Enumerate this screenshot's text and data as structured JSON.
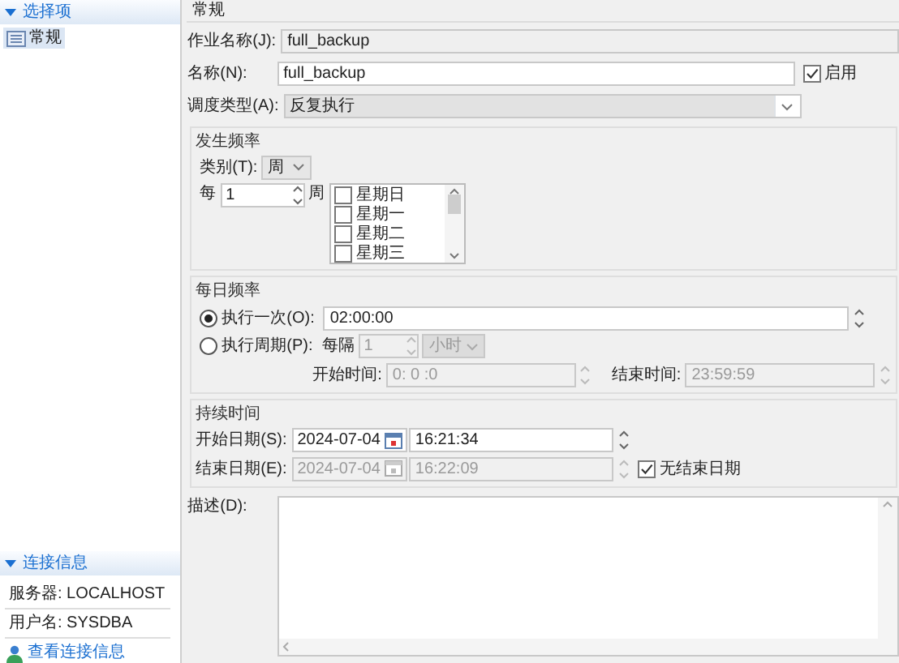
{
  "options_panel": {
    "title": "选择项",
    "expanded": true,
    "items": [
      {
        "label": "常规",
        "selected": true
      }
    ]
  },
  "connection_panel": {
    "title": "连接信息",
    "expanded": true,
    "lines": [
      "服务器: LOCALHOST",
      "用户名: SYSDBA"
    ],
    "link": "查看连接信息"
  },
  "page": {
    "title": "常规"
  },
  "general": {
    "job_name": {
      "label": "作业名称(J):",
      "value": "full_backup"
    },
    "name": {
      "label": "名称(N):",
      "value": "full_backup"
    },
    "enabled": {
      "label": "启用",
      "checked": true
    },
    "schedule_type": {
      "label": "调度类型(A):",
      "value": "反复执行"
    }
  },
  "occurrence": {
    "title": "发生频率",
    "category": {
      "label": "类别(T):",
      "value": "周"
    },
    "every": {
      "label": "每",
      "value": "1",
      "unit": "周"
    },
    "weekdays": [
      {
        "label": "星期日",
        "checked": false
      },
      {
        "label": "星期一",
        "checked": false
      },
      {
        "label": "星期二",
        "checked": false
      },
      {
        "label": "星期三",
        "checked": false
      }
    ]
  },
  "daily": {
    "title": "每日频率",
    "options": [
      {
        "kind": "once",
        "label": "执行一次(O):",
        "selected": true
      },
      {
        "kind": "periodic",
        "label": "执行周期(P):",
        "selected": false
      }
    ],
    "once_time": "02:00:00",
    "interval": {
      "label": "每隔",
      "value": "1",
      "unit": "小时",
      "disabled": true
    },
    "start_time": {
      "label": "开始时间:",
      "value": "0: 0 :0",
      "disabled": true
    },
    "end_time": {
      "label": "结束时间:",
      "value": "23:59:59",
      "disabled": true
    }
  },
  "duration": {
    "title": "持续时间",
    "start": {
      "label": "开始日期(S):",
      "date": "2024-07-04",
      "time": "16:21:34",
      "disabled": false
    },
    "end": {
      "label": "结束日期(E):",
      "date": "2024-07-04",
      "time": "16:22:09",
      "disabled": true
    },
    "no_end": {
      "label": "无结束日期",
      "checked": true
    }
  },
  "description": {
    "label": "描述(D):"
  }
}
